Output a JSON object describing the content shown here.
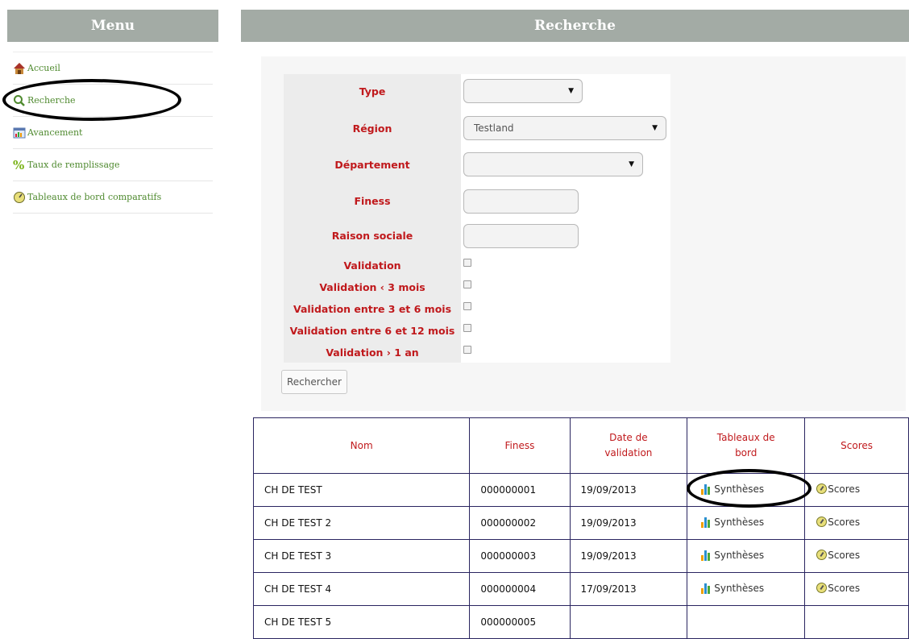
{
  "menu": {
    "title": "Menu",
    "items": [
      {
        "label": "Accueil",
        "icon": "home-icon"
      },
      {
        "label": "Recherche",
        "icon": "search-icon"
      },
      {
        "label": "Avancement",
        "icon": "chart-window-icon"
      },
      {
        "label": "Taux de remplissage",
        "icon": "percent-icon"
      },
      {
        "label": "Tableaux de bord comparatifs",
        "icon": "gauge-icon"
      }
    ]
  },
  "search": {
    "title": "Recherche",
    "labels": {
      "type": "Type",
      "region": "Région",
      "departement": "Département",
      "finess": "Finess",
      "raison_sociale": "Raison sociale",
      "validation": "Validation",
      "validation_3": "Validation ‹ 3 mois",
      "validation_3_6": "Validation entre 3 et 6 mois",
      "validation_6_12": "Validation entre 6 et 12 mois",
      "validation_1an": "Validation › 1 an"
    },
    "type_value": "",
    "region_value": "Testland",
    "departement_value": "",
    "finess_value": "",
    "raison_sociale_value": "",
    "button": "Rechercher"
  },
  "results": {
    "headers": {
      "nom": "Nom",
      "finess": "Finess",
      "date1": "Date de",
      "date2": "validation",
      "tab1": "Tableaux de",
      "tab2": "bord",
      "scores": "Scores"
    },
    "link_syntheses": "Synthèses",
    "link_scores": "Scores",
    "rows": [
      {
        "nom": "CH DE TEST",
        "finess": "000000001",
        "date": "19/09/2013",
        "links": true
      },
      {
        "nom": "CH DE TEST 2",
        "finess": "000000002",
        "date": "19/09/2013",
        "links": true
      },
      {
        "nom": "CH DE TEST 3",
        "finess": "000000003",
        "date": "19/09/2013",
        "links": true
      },
      {
        "nom": "CH DE TEST 4",
        "finess": "000000004",
        "date": "17/09/2013",
        "links": true
      },
      {
        "nom": "CH DE TEST 5",
        "finess": "000000005",
        "date": "",
        "links": false
      }
    ]
  },
  "colors": {
    "header_bg": "#a3aba5",
    "label_red": "#c0191c",
    "menu_green": "#4f8a2f",
    "table_border": "#2a2560"
  }
}
